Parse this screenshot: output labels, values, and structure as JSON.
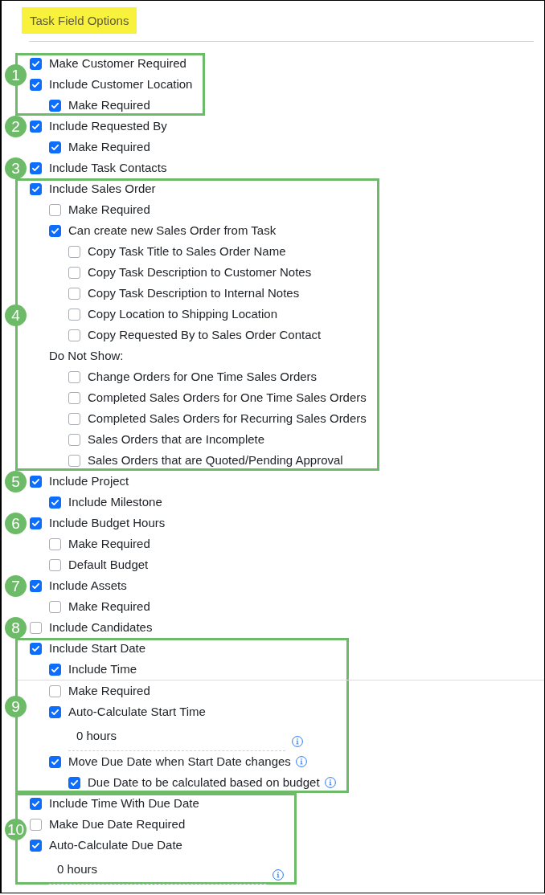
{
  "title": "Task Field Options",
  "sections": [
    {
      "callout": "1",
      "framed": true,
      "options": [
        {
          "kind": "checkbox",
          "label": "Make Customer Required",
          "checked": true
        },
        {
          "kind": "checkbox",
          "label": "Include Customer Location",
          "checked": true,
          "children": [
            {
              "kind": "checkbox",
              "label": "Make Required",
              "checked": true
            }
          ]
        }
      ]
    },
    {
      "callout": "2",
      "framed": false,
      "options": [
        {
          "kind": "checkbox",
          "label": "Include Requested By",
          "checked": true,
          "children": [
            {
              "kind": "checkbox",
              "label": "Make Required",
              "checked": true
            }
          ]
        }
      ]
    },
    {
      "callout": "3",
      "framed": false,
      "options": [
        {
          "kind": "checkbox",
          "label": "Include Task Contacts",
          "checked": true
        }
      ]
    },
    {
      "callout": "4",
      "framed": true,
      "options": [
        {
          "kind": "checkbox",
          "label": "Include Sales Order",
          "checked": true,
          "children": [
            {
              "kind": "checkbox",
              "label": "Make Required",
              "checked": false
            },
            {
              "kind": "checkbox",
              "label": "Can create new Sales Order from Task",
              "checked": true,
              "children": [
                {
                  "kind": "checkbox",
                  "label": "Copy Task Title to Sales Order Name",
                  "checked": false
                },
                {
                  "kind": "checkbox",
                  "label": "Copy Task Description to Customer Notes",
                  "checked": false
                },
                {
                  "kind": "checkbox",
                  "label": "Copy Task Description to Internal Notes",
                  "checked": false
                },
                {
                  "kind": "checkbox",
                  "label": "Copy Location to Shipping Location",
                  "checked": false
                },
                {
                  "kind": "checkbox",
                  "label": "Copy Requested By to Sales Order Contact",
                  "checked": false
                }
              ]
            },
            {
              "kind": "heading",
              "label": "Do Not Show:",
              "children": [
                {
                  "kind": "checkbox",
                  "label": "Change Orders for One Time Sales Orders",
                  "checked": false
                },
                {
                  "kind": "checkbox",
                  "label": "Completed Sales Orders for One Time Sales Orders",
                  "checked": false
                },
                {
                  "kind": "checkbox",
                  "label": "Completed Sales Orders for Recurring Sales Orders",
                  "checked": false
                },
                {
                  "kind": "checkbox",
                  "label": "Sales Orders that are Incomplete",
                  "checked": false
                },
                {
                  "kind": "checkbox",
                  "label": "Sales Orders that are Quoted/Pending Approval",
                  "checked": false
                }
              ]
            }
          ]
        }
      ]
    },
    {
      "callout": "5",
      "framed": false,
      "options": [
        {
          "kind": "checkbox",
          "label": "Include Project",
          "checked": true,
          "children": [
            {
              "kind": "checkbox",
              "label": "Include Milestone",
              "checked": true
            }
          ]
        }
      ]
    },
    {
      "callout": "6",
      "framed": false,
      "options": [
        {
          "kind": "checkbox",
          "label": "Include Budget Hours",
          "checked": true,
          "children": [
            {
              "kind": "checkbox",
              "label": "Make Required",
              "checked": false
            },
            {
              "kind": "checkbox",
              "label": "Default Budget",
              "checked": false
            }
          ]
        }
      ]
    },
    {
      "callout": "7",
      "framed": false,
      "options": [
        {
          "kind": "checkbox",
          "label": "Include Assets",
          "checked": true,
          "children": [
            {
              "kind": "checkbox",
              "label": "Make Required",
              "checked": false
            }
          ]
        }
      ]
    },
    {
      "callout": "8",
      "framed": false,
      "options": [
        {
          "kind": "checkbox",
          "label": "Include Candidates",
          "checked": false
        }
      ]
    },
    {
      "callout": "9",
      "framed": true,
      "options": [
        {
          "kind": "checkbox",
          "label": "Include Start Date",
          "checked": true,
          "children": [
            {
              "kind": "checkbox",
              "label": "Include Time",
              "checked": true
            },
            {
              "kind": "divider"
            },
            {
              "kind": "checkbox",
              "label": "Make Required",
              "checked": false
            },
            {
              "kind": "checkbox",
              "label": "Auto-Calculate Start Time",
              "checked": true,
              "children": [
                {
                  "kind": "field",
                  "value": "0 hours",
                  "info": true
                }
              ]
            },
            {
              "kind": "checkbox",
              "label": "Move Due Date when Start Date changes",
              "checked": true,
              "info": true,
              "children": [
                {
                  "kind": "checkbox",
                  "label": "Due Date to be calculated based on budget",
                  "checked": true,
                  "info": true
                }
              ]
            }
          ]
        }
      ]
    },
    {
      "callout": "10",
      "framed": true,
      "options": [
        {
          "kind": "checkbox",
          "label": "Include Time With Due Date",
          "checked": true
        },
        {
          "kind": "checkbox",
          "label": "Make Due Date Required",
          "checked": false
        },
        {
          "kind": "checkbox",
          "label": "Auto-Calculate Due Date",
          "checked": true,
          "children": [
            {
              "kind": "field",
              "value": "0 hours",
              "info": true
            }
          ]
        }
      ]
    }
  ]
}
